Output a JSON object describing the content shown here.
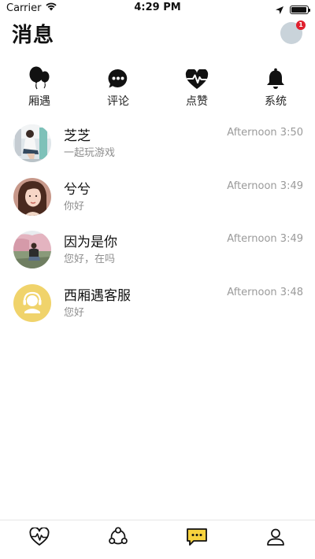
{
  "status_bar": {
    "carrier": "Carrier",
    "time": "4:29 PM",
    "battery_level": 0.95
  },
  "header": {
    "title": "消息",
    "avatar_badge_count": "1"
  },
  "categories": [
    {
      "label": "厢遇",
      "icon": "balloons-icon"
    },
    {
      "label": "评论",
      "icon": "chat-bubble-icon"
    },
    {
      "label": "点赞",
      "icon": "heartbeat-icon"
    },
    {
      "label": "系统",
      "icon": "bell-icon"
    }
  ],
  "conversations": [
    {
      "name": "芝芝",
      "message": "一起玩游戏",
      "time": "Afternoon 3:50",
      "avatar": "photo-avatar"
    },
    {
      "name": "兮兮",
      "message": "你好",
      "time": "Afternoon 3:49",
      "avatar": "photo-avatar"
    },
    {
      "name": "因为是你",
      "message": "您好，在吗",
      "time": "Afternoon 3:49",
      "avatar": "photo-avatar"
    },
    {
      "name": "西厢遇客服",
      "message": "您好",
      "time": "Afternoon 3:48",
      "avatar": "support-agent-avatar"
    }
  ],
  "tabbar": {
    "tabs": [
      {
        "icon": "heart-pulse-icon",
        "active": false
      },
      {
        "icon": "network-icon",
        "active": false
      },
      {
        "icon": "message-icon",
        "active": true
      },
      {
        "icon": "profile-icon",
        "active": false
      }
    ]
  },
  "colors": {
    "accent": "#f7d23e",
    "badge": "#e0202e",
    "support_avatar": "#f0d36b"
  }
}
